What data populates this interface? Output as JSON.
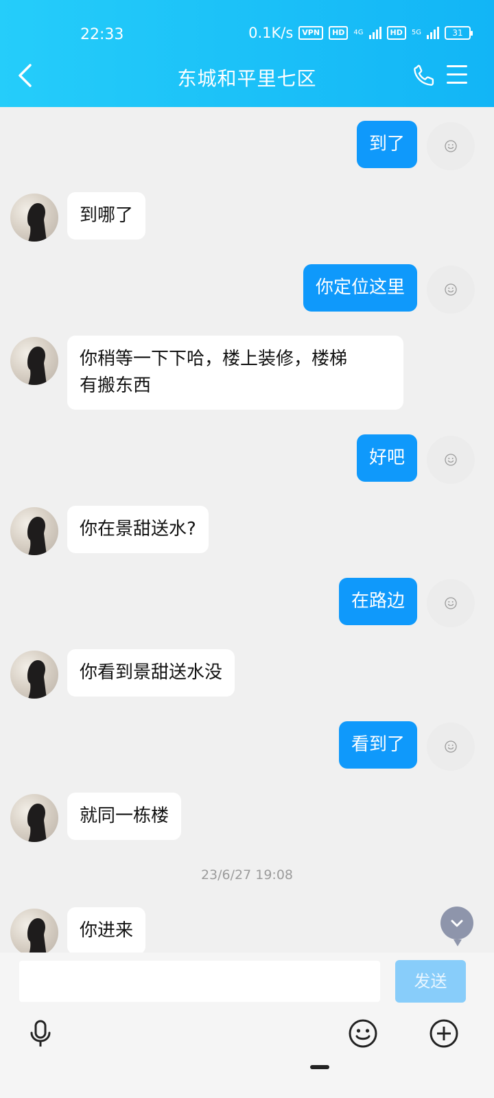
{
  "status": {
    "time": "22:33",
    "speed": "0.1K/s",
    "vpn": "VPN",
    "hd": "HD",
    "net1": "4G",
    "net2": "5G",
    "battery": "31"
  },
  "header": {
    "title": "东城和平里七区"
  },
  "messages": [
    {
      "from": "me",
      "text": "到了"
    },
    {
      "from": "peer",
      "text": "到哪了"
    },
    {
      "from": "me",
      "text": "你定位这里"
    },
    {
      "from": "peer",
      "text": "你稍等一下下哈，楼上装修，楼梯\n有搬东西"
    },
    {
      "from": "me",
      "text": "好吧"
    },
    {
      "from": "peer",
      "text": "你在景甜送水?"
    },
    {
      "from": "me",
      "text": "在路边"
    },
    {
      "from": "peer",
      "text": "你看到景甜送水没"
    },
    {
      "from": "me",
      "text": "看到了"
    },
    {
      "from": "peer",
      "text": "就同一栋楼"
    },
    {
      "from": "peer",
      "text": "你进来"
    }
  ],
  "timestamp": "23/6/27 19:08",
  "composer": {
    "placeholder": "",
    "send_label": "发送"
  },
  "colors": {
    "header": "#12b5f6",
    "out_bubble": "#0f99fb",
    "send_disabled": "#88cdfa"
  }
}
